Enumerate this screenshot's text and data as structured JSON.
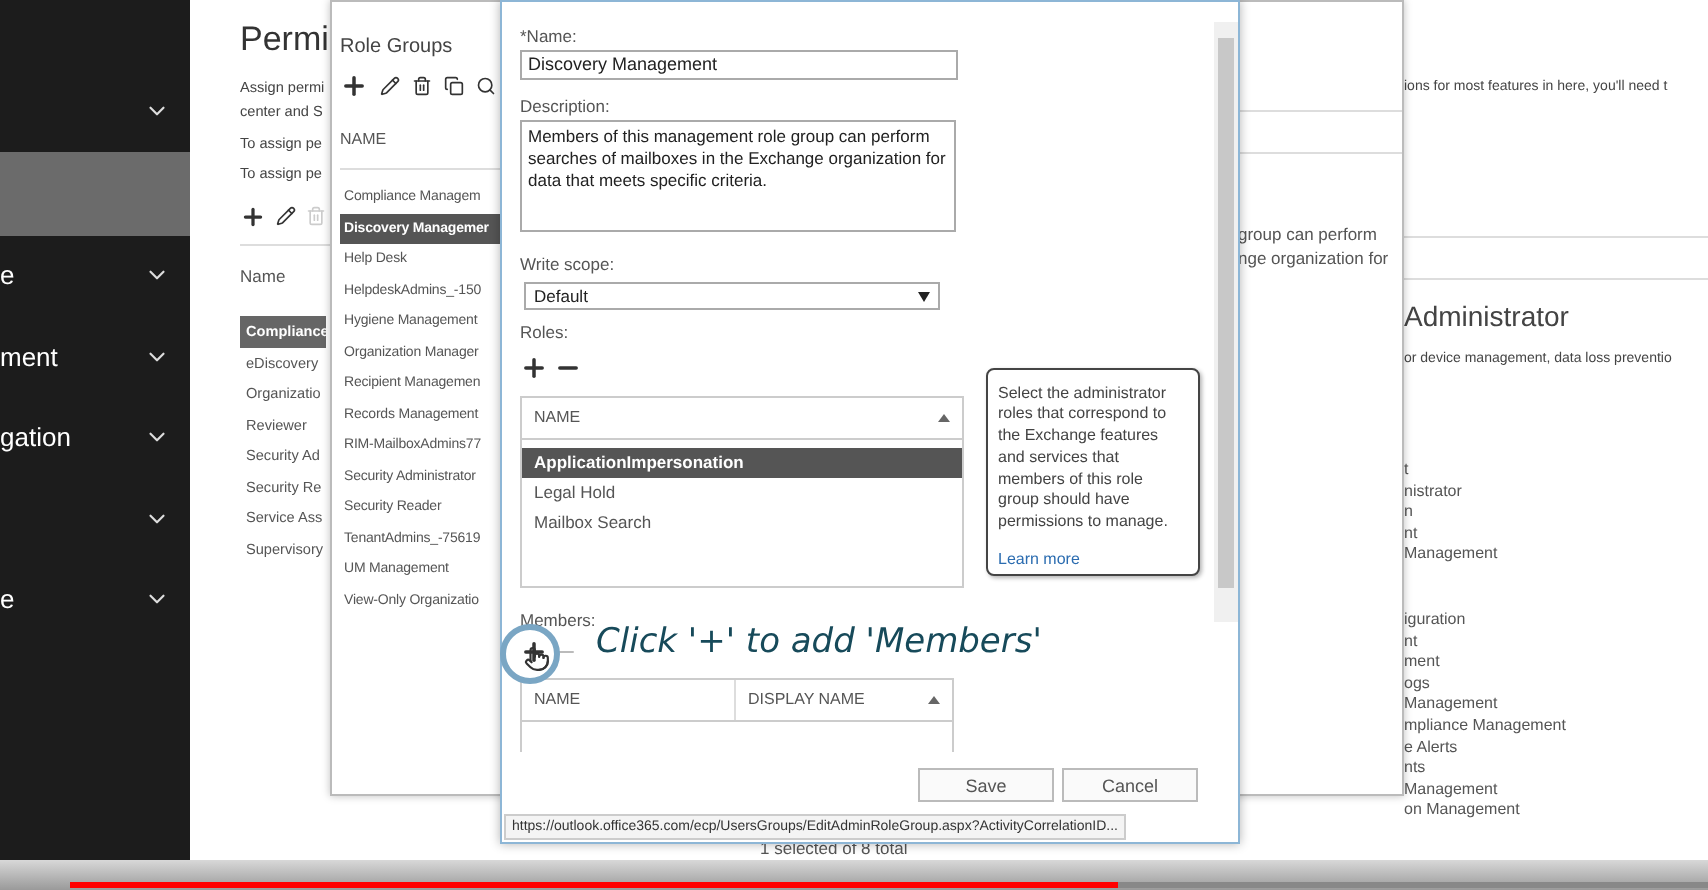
{
  "sidebar": {
    "items": [
      {
        "chevron": true,
        "selected": false
      },
      {
        "chevron": false,
        "selected": true
      },
      {
        "label": "e",
        "chevron": true,
        "selected": false
      },
      {
        "label": "ment",
        "chevron": true,
        "selected": false
      },
      {
        "label": "gation",
        "chevron": true,
        "selected": false
      },
      {
        "chevron": true,
        "selected": false
      },
      {
        "label": "e",
        "chevron": true,
        "selected": false
      }
    ]
  },
  "page": {
    "title": "Permi",
    "intro": [
      "Assign permi",
      "center and S"
    ],
    "assign_lines": [
      "To assign pe",
      "To assign pe"
    ],
    "list_header": "Name",
    "rows": [
      {
        "label": "Compliance",
        "selected": true
      },
      {
        "label": "eDiscovery",
        "selected": false
      },
      {
        "label": "Organizatio",
        "selected": false
      },
      {
        "label": "Reviewer",
        "selected": false
      },
      {
        "label": "Security Ad",
        "selected": false
      },
      {
        "label": "Security Re",
        "selected": false
      },
      {
        "label": "Service Ass",
        "selected": false
      },
      {
        "label": "Supervisory",
        "selected": false
      }
    ],
    "right_intro": "ions for most features in here, you'll need t",
    "detail_heading": "Administrator",
    "detail_description": "or device management, data loss preventio",
    "role_fragment_groups": [
      [
        "t",
        "nistrator",
        "n",
        "nt",
        "Management"
      ],
      [
        "iguration",
        "nt",
        "ment",
        "ogs",
        "Management",
        "mpliance Management",
        "e Alerts",
        "nts",
        "Management",
        "on Management"
      ]
    ],
    "footer": "1 selected of 8 total"
  },
  "role_groups": {
    "title": "Role Groups",
    "header": "NAME",
    "rows": [
      {
        "label": "Compliance Managem",
        "selected": false
      },
      {
        "label": "Discovery Managemer",
        "selected": true
      },
      {
        "label": "Help Desk",
        "selected": false
      },
      {
        "label": "HelpdeskAdmins_-150",
        "selected": false
      },
      {
        "label": "Hygiene Management",
        "selected": false
      },
      {
        "label": "Organization Manager",
        "selected": false
      },
      {
        "label": "Recipient Managemen",
        "selected": false
      },
      {
        "label": "Records Management",
        "selected": false
      },
      {
        "label": "RIM-MailboxAdmins77",
        "selected": false
      },
      {
        "label": "Security Administrator",
        "selected": false
      },
      {
        "label": "Security Reader",
        "selected": false
      },
      {
        "label": "TenantAdmins_-75619",
        "selected": false
      },
      {
        "label": "UM Management",
        "selected": false
      },
      {
        "label": "View-Only Organizatio",
        "selected": false
      }
    ],
    "detail_lines": [
      "group can perform",
      "nge organization for"
    ]
  },
  "dialog": {
    "name_label": "*Name:",
    "name_value": "Discovery Management",
    "description_label": "Description:",
    "description": "Members of this management role group can perform searches of mailboxes in the Exchange organization for data that meets specific criteria.",
    "write_scope_label": "Write scope:",
    "write_scope": "Default",
    "roles_label": "Roles:",
    "roles_header": "NAME",
    "roles": [
      {
        "label": "ApplicationImpersonation",
        "selected": true
      },
      {
        "label": "Legal Hold",
        "selected": false
      },
      {
        "label": "Mailbox Search",
        "selected": false
      }
    ],
    "tooltip": "Select the administrator roles that correspond to the Exchange features and services that members of this role group should have permissions to manage.",
    "tooltip_link": "Learn more",
    "members_label": "Members:",
    "members_columns": [
      "NAME",
      "DISPLAY NAME"
    ],
    "buttons": [
      "Save",
      "Cancel"
    ],
    "status_url": "https://outlook.office365.com/ecp/UsersGroups/EditAdminRoleGroup.aspx?ActivityCorrelationID..."
  },
  "annotation": {
    "text": "Click '+' to add 'Members'"
  },
  "video_progress": {
    "level": 0.64
  }
}
